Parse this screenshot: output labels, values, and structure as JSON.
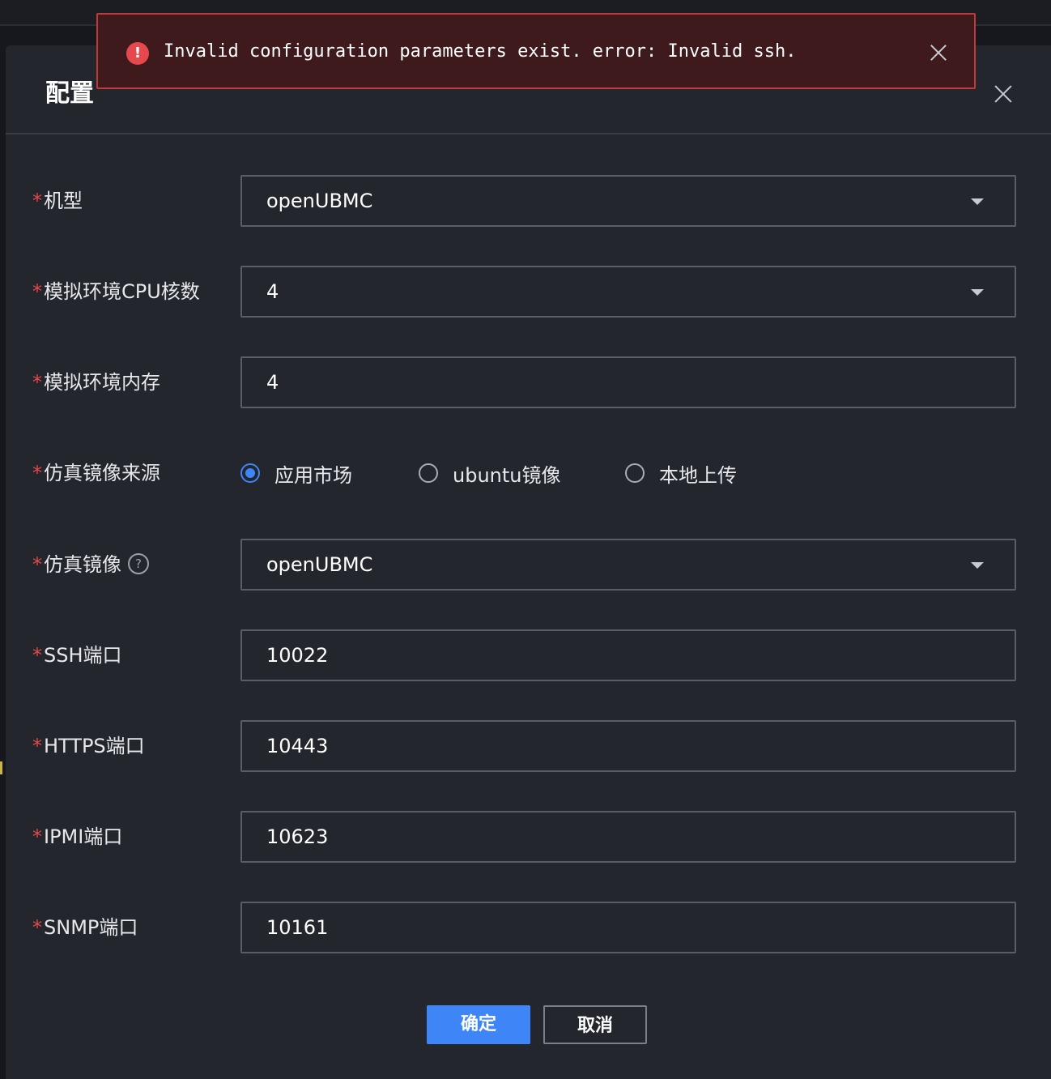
{
  "dialog": {
    "title": "配置"
  },
  "form": {
    "required_mark": "*",
    "model": {
      "label": "机型",
      "value": "openUBMC"
    },
    "cpu": {
      "label": "模拟环境CPU核数",
      "value": "4"
    },
    "memory": {
      "label": "模拟环境内存",
      "value": "4"
    },
    "image_source": {
      "label": "仿真镜像来源",
      "options": [
        {
          "label": "应用市场",
          "checked": true
        },
        {
          "label": "ubuntu镜像",
          "checked": false
        },
        {
          "label": "本地上传",
          "checked": false
        }
      ]
    },
    "image": {
      "label": "仿真镜像",
      "help_icon": "?",
      "value": "openUBMC"
    },
    "ssh_port": {
      "label": "SSH端口",
      "value": "10022"
    },
    "https_port": {
      "label": "HTTPS端口",
      "value": "10443"
    },
    "ipmi_port": {
      "label": "IPMI端口",
      "value": "10623"
    },
    "snmp_port": {
      "label": "SNMP端口",
      "value": "10161"
    }
  },
  "buttons": {
    "confirm": "确定",
    "cancel": "取消"
  },
  "toast": {
    "icon": "!",
    "message": "Invalid configuration parameters exist. error: Invalid ssh."
  },
  "colors": {
    "accent": "#3e86f7",
    "error": "#e5484d",
    "dialog_bg": "#23262c"
  }
}
